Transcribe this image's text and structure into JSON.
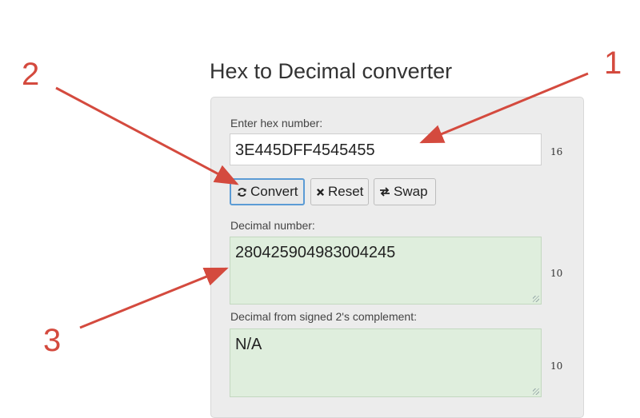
{
  "page": {
    "title": "Hex to Decimal converter"
  },
  "hex_section": {
    "label": "Enter hex number:",
    "value": "3E445DFF4545455",
    "base": "16"
  },
  "buttons": {
    "convert": {
      "label": "Convert",
      "icon": "refresh-icon"
    },
    "reset": {
      "label": "Reset",
      "icon": "close-icon"
    },
    "swap": {
      "label": "Swap",
      "icon": "swap-icon"
    }
  },
  "decimal_section": {
    "label": "Decimal number:",
    "value": "280425904983004245",
    "base": "10"
  },
  "signed_section": {
    "label": "Decimal from signed 2's complement:",
    "value": "N/A",
    "base": "10"
  },
  "annotations": {
    "one": "1",
    "two": "2",
    "three": "3",
    "color": "#d44a3e"
  }
}
